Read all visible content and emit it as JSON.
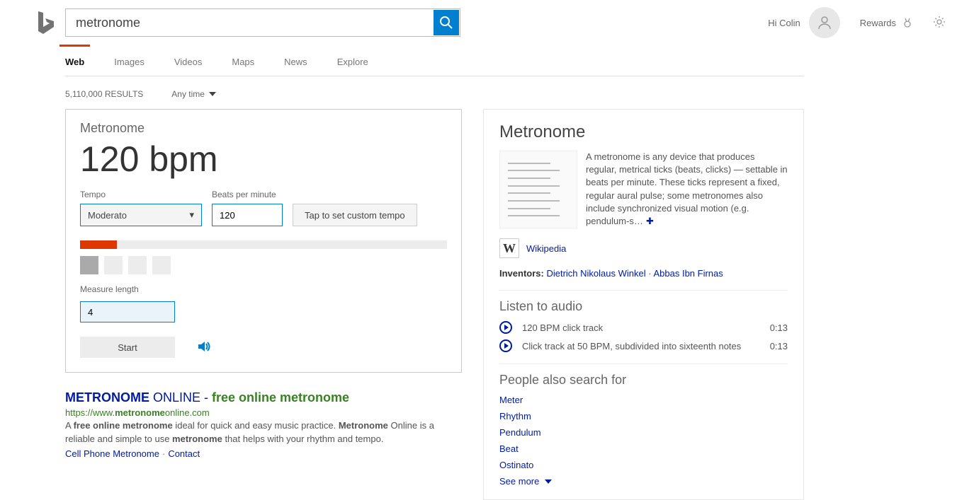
{
  "header": {
    "search_value": "metronome",
    "greeting": "Hi Colin",
    "rewards_label": "Rewards"
  },
  "tabs": {
    "items": [
      {
        "label": "Web",
        "active": true
      },
      {
        "label": "Images",
        "active": false
      },
      {
        "label": "Videos",
        "active": false
      },
      {
        "label": "Maps",
        "active": false
      },
      {
        "label": "News",
        "active": false
      },
      {
        "label": "Explore",
        "active": false
      }
    ]
  },
  "meta": {
    "results_count": "5,110,000 RESULTS",
    "time_filter": "Any time"
  },
  "metronome": {
    "title": "Metronome",
    "bpm_display": "120 bpm",
    "tempo_label": "Tempo",
    "tempo_value": "Moderato",
    "bpm_label": "Beats per minute",
    "bpm_value": "120",
    "tap_label": "Tap to set custom tempo",
    "measure_label": "Measure length",
    "measure_value": "4",
    "start_label": "Start"
  },
  "organic": {
    "title_part1": "METRONOME",
    "title_part2": " ONLINE - ",
    "title_part3": "free online metronome",
    "cite_pre": "https://www.",
    "cite_bold": "metronome",
    "cite_post": "online.com",
    "snippet_parts": {
      "p0": "A ",
      "b1": "free online metronome",
      "p2": " ideal for quick and easy music practice. ",
      "b3": "Metronome",
      "p4": " Online is a reliable and simple to use ",
      "b5": "metronome",
      "p6": " that helps with your rhythm and tempo."
    },
    "sublinks": {
      "l1": "Cell Phone Metronome",
      "l2": "Contact"
    }
  },
  "kp": {
    "title": "Metronome",
    "desc": "A metronome is any device that produces regular, metrical ticks (beats, clicks) — settable in beats per minute. These ticks represent a fixed, regular aural pulse; some metronomes also include synchronized visual motion (e.g. pendulum-s…",
    "source_label": "Wikipedia",
    "inventors_label": "Inventors:",
    "inventors": {
      "i1": "Dietrich Nikolaus Winkel",
      "i2": "Abbas Ibn Firnas"
    },
    "audio_title": "Listen to audio",
    "audio": [
      {
        "title": "120 BPM click track",
        "dur": "0:13"
      },
      {
        "title": "Click track at 50 BPM, subdivided into sixteenth notes",
        "dur": "0:13"
      }
    ],
    "pas_title": "People also search for",
    "pas": [
      "Meter",
      "Rhythm",
      "Pendulum",
      "Beat",
      "Ostinato"
    ],
    "see_more": "See more"
  }
}
